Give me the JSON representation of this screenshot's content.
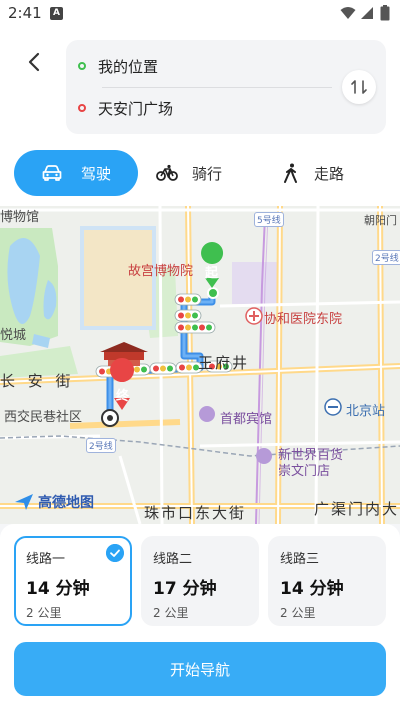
{
  "status_bar": {
    "time": "2:41",
    "notification_badge": "A"
  },
  "route": {
    "start": "我的位置",
    "end": "天安门广场"
  },
  "modes": [
    {
      "label": "驾驶",
      "icon": "car-icon",
      "active": true
    },
    {
      "label": "骑行",
      "icon": "bicycle-icon",
      "active": false
    },
    {
      "label": "走路",
      "icon": "walking-icon",
      "active": false
    }
  ],
  "map": {
    "labels": {
      "museum_top": "博物馆",
      "line5": "5号线",
      "chaoyangmen": "朝阳门",
      "palace_museum": "故宫博物院",
      "line2_right": "2号线",
      "yuecheng": "悦城",
      "xiehe": "协和医院东院",
      "wangfujing": "王府井",
      "changanjie": "长 安 街",
      "xijiaominxiang": "西交民巷社区",
      "shoudu_hotel": "首都宾馆",
      "beijing_station": "北京站",
      "line2_bottom": "2号线",
      "new_world": "新世界百货",
      "chongwenmen": "崇文门店",
      "zhushikou": "珠市口东大街",
      "guangqumen": "广渠门内大",
      "start_marker": "起",
      "end_marker": "终"
    },
    "logo_text": "高德地图"
  },
  "routes": [
    {
      "name": "线路一",
      "duration": "14 分钟",
      "distance": "2 公里",
      "selected": true
    },
    {
      "name": "线路二",
      "duration": "17 分钟",
      "distance": "2 公里",
      "selected": false
    },
    {
      "name": "线路三",
      "duration": "14 分钟",
      "distance": "2 公里",
      "selected": false
    }
  ],
  "start_button": "开始导航",
  "colors": {
    "accent": "#2aa3f5",
    "route_blue": "#3d8fe8",
    "start_green": "#3fbf4f",
    "end_red": "#e84545"
  }
}
